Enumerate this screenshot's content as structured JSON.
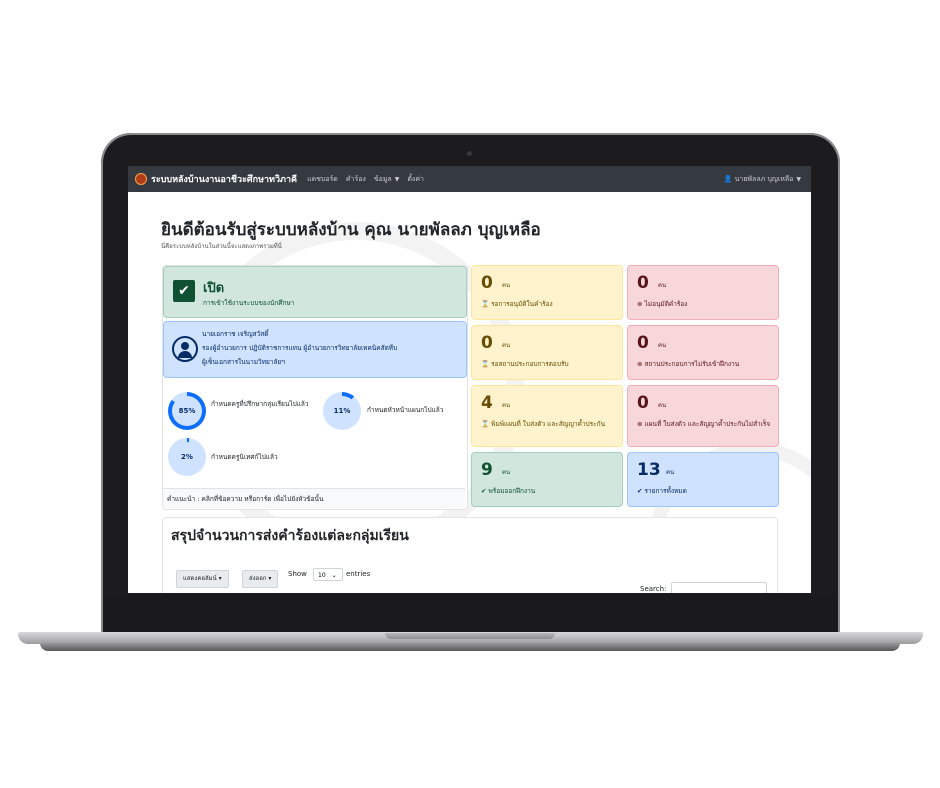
{
  "navbar": {
    "brand": "ระบบหลังบ้านงานอาชีวะศึกษาทวิภาคี",
    "items": [
      {
        "label": "แดชบอร์ด"
      },
      {
        "label": "คำร้อง"
      },
      {
        "label": "ข้อมูล"
      },
      {
        "label": "ตั้งค่า"
      }
    ],
    "user": "นายพัลลภ บุญเหลือ"
  },
  "header": {
    "title": "ยินดีต้อนรับสู่ระบบหลังบ้าน คุณ นายพัลลภ บุญเหลือ",
    "subtitle": "นี่คือระบบหลังบ้านในส่วนนี้จะแสดงภาพรวมที่นี่"
  },
  "status_card": {
    "title": "เปิด",
    "subtitle": "การเข้าใช้งานระบบของนักศึกษา"
  },
  "advisor_card": {
    "line1": "นายเอกราช เจริญสวัสดิ์",
    "line2": "รองผู้อำนวยการ ปฏิบัติราชการแทน ผู้อำนวยการวิทยาลัยเทคนิคสัตหีบ",
    "line3": "ผู้เซ็นเอกสารในนามวิทยาลัยฯ"
  },
  "progress": [
    {
      "value": 85,
      "label_text": "85%",
      "text": "กำหนดครูที่ปรึกษากลุ่มเรียนไปแล้ว"
    },
    {
      "value": 11,
      "label_text": "11%",
      "text": "กำหนดหัวหน้าแผนกไปแล้ว"
    },
    {
      "value": 2,
      "label_text": "2%",
      "text": "กำหนดครูนิเทศก์ไปแล้ว"
    }
  ],
  "hint": "คำแนะนำ : คลิกที่ข้อความ หรือการ์ด เพื่อไปยังหัวข้อนั้น",
  "stats": [
    {
      "value": "0",
      "unit": "คน",
      "label": "⌛ รอการอนุมัติในคำร้อง"
    },
    {
      "value": "0",
      "unit": "คน",
      "label": "⊗ ไม่อนุมัติคำร้อง"
    },
    {
      "value": "0",
      "unit": "คน",
      "label": "⌛ รอสถานประกอบการตอบรับ"
    },
    {
      "value": "0",
      "unit": "คน",
      "label": "⊗ สถานประกอบการไม่รับเข้าฝึกงาน"
    },
    {
      "value": "4",
      "unit": "คน",
      "label": "⌛ พิมพ์แผนที่ ใบส่งตัว และสัญญาค้ำประกัน"
    },
    {
      "value": "0",
      "unit": "คน",
      "label": "⊗ แผนที่ ใบส่งตัว และสัญญาค้ำประกันไม่สำเร็จ"
    },
    {
      "value": "9",
      "unit": "คน",
      "label": "✔ พร้อมออกฝึกงาน"
    },
    {
      "value": "13",
      "unit": "คน",
      "label": "✔ รายการทั้งหมด"
    }
  ],
  "summary": {
    "title": "สรุปจำนวนการส่งคำร้องแต่ละกลุ่มเรียน",
    "btn_columns": "แสดงคอลัมน์",
    "btn_export": "ส่งออก",
    "show_label": "Show",
    "page_size": "10",
    "entries_label": "entries",
    "search_label": "Search:"
  },
  "colors": {
    "navbar": "#343a40",
    "ring": "#0d6efd",
    "ring_track": "#cfe2ff"
  }
}
